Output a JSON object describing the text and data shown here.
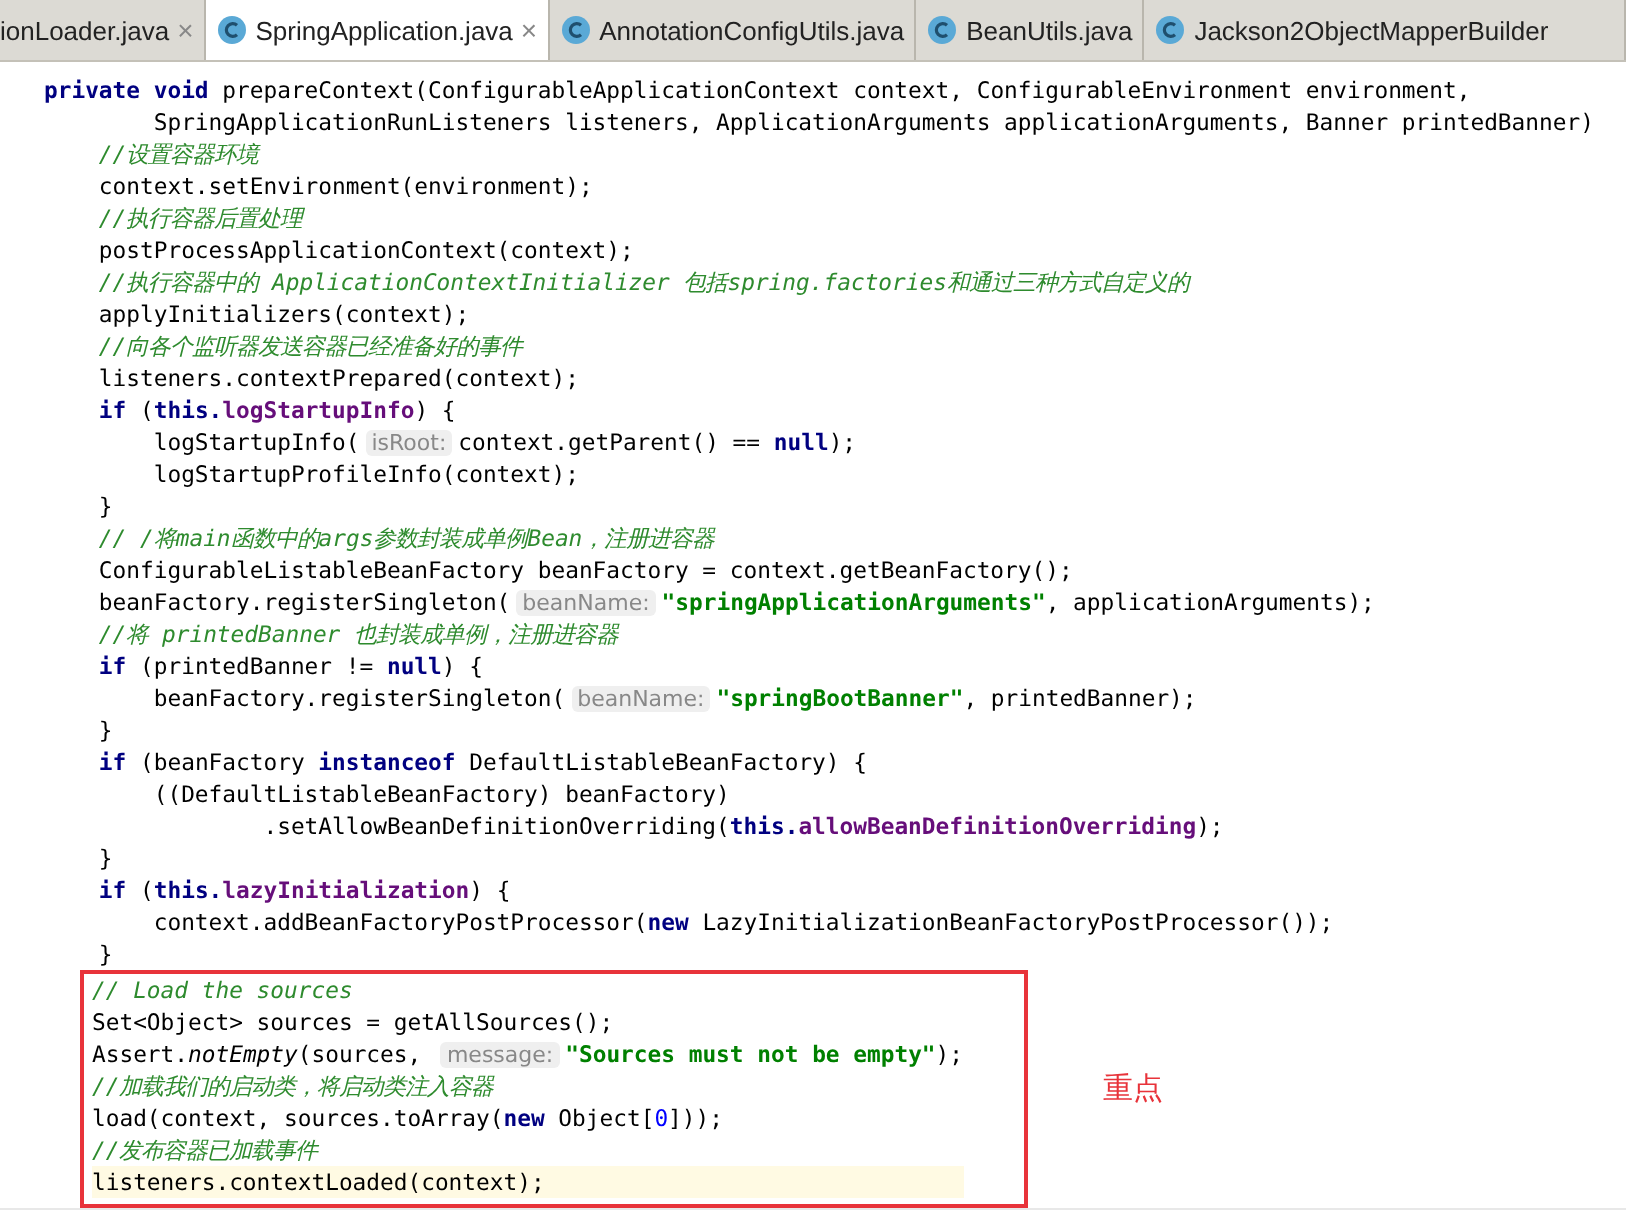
{
  "tabs": [
    {
      "label": "ionLoader.java",
      "selected": false,
      "icon": false,
      "close": "×"
    },
    {
      "label": "SpringApplication.java",
      "selected": true,
      "icon": true,
      "close": "×"
    },
    {
      "label": "AnnotationConfigUtils.java",
      "selected": false,
      "icon": true
    },
    {
      "label": "BeanUtils.java",
      "selected": false,
      "icon": true
    },
    {
      "label": "Jackson2ObjectMapperBuilder",
      "selected": false,
      "icon": true
    }
  ],
  "code_lines": [
    [
      {
        "kind": "keyword",
        "text": "private void "
      },
      {
        "kind": "plain",
        "text": "prepareContext(ConfigurableApplicationContext context, ConfigurableEnvironment environment,"
      }
    ],
    [
      {
        "kind": "plain",
        "text": "        SpringApplicationRunListeners listeners, ApplicationArguments applicationArguments, Banner printedBanner)"
      }
    ],
    [
      {
        "kind": "comment",
        "text": "    //设置容器环境"
      }
    ],
    [
      {
        "kind": "plain",
        "text": "    context.setEnvironment(environment);"
      }
    ],
    [
      {
        "kind": "comment",
        "text": "    //执行容器后置处理"
      }
    ],
    [
      {
        "kind": "plain",
        "text": "    postProcessApplicationContext(context);"
      }
    ],
    [
      {
        "kind": "comment",
        "text": "    //执行容器中的 ApplicationContextInitializer 包括spring.factories和通过三种方式自定义的"
      }
    ],
    [
      {
        "kind": "plain",
        "text": "    applyInitializers(context);"
      }
    ],
    [
      {
        "kind": "comment",
        "text": "    //向各个监听器发送容器已经准备好的事件"
      }
    ],
    [
      {
        "kind": "plain",
        "text": "    listeners.contextPrepared(context);"
      }
    ],
    [
      {
        "kind": "keyword",
        "text": "    if "
      },
      {
        "kind": "plain",
        "text": "("
      },
      {
        "kind": "keyword",
        "text": "this."
      },
      {
        "kind": "field",
        "text": "logStartupInfo"
      },
      {
        "kind": "plain",
        "text": ") {"
      }
    ],
    [
      {
        "kind": "plain",
        "text": "        logStartupInfo("
      },
      {
        "kind": "hint",
        "text": "isRoot:"
      },
      {
        "kind": "plain",
        "text": "context.getParent() == "
      },
      {
        "kind": "keyword",
        "text": "null"
      },
      {
        "kind": "plain",
        "text": ");"
      }
    ],
    [
      {
        "kind": "plain",
        "text": "        logStartupProfileInfo(context);"
      }
    ],
    [
      {
        "kind": "plain",
        "text": "    }"
      }
    ],
    [
      {
        "kind": "comment",
        "text": "    // /将main函数中的args参数封装成单例Bean，注册进容器"
      }
    ],
    [
      {
        "kind": "plain",
        "text": "    ConfigurableListableBeanFactory beanFactory = context.getBeanFactory();"
      }
    ],
    [
      {
        "kind": "plain",
        "text": "    beanFactory.registerSingleton("
      },
      {
        "kind": "hint",
        "text": "beanName:"
      },
      {
        "kind": "string",
        "text": "\"springApplicationArguments\""
      },
      {
        "kind": "plain",
        "text": ", applicationArguments);"
      }
    ],
    [
      {
        "kind": "comment",
        "text": "    //将 printedBanner 也封装成单例，注册进容器"
      }
    ],
    [
      {
        "kind": "keyword",
        "text": "    if "
      },
      {
        "kind": "plain",
        "text": "(printedBanner != "
      },
      {
        "kind": "keyword",
        "text": "null"
      },
      {
        "kind": "plain",
        "text": ") {"
      }
    ],
    [
      {
        "kind": "plain",
        "text": "        beanFactory.registerSingleton("
      },
      {
        "kind": "hint",
        "text": "beanName:"
      },
      {
        "kind": "string",
        "text": "\"springBootBanner\""
      },
      {
        "kind": "plain",
        "text": ", printedBanner);"
      }
    ],
    [
      {
        "kind": "plain",
        "text": "    }"
      }
    ],
    [
      {
        "kind": "keyword",
        "text": "    if "
      },
      {
        "kind": "plain",
        "text": "(beanFactory "
      },
      {
        "kind": "keyword",
        "text": "instanceof "
      },
      {
        "kind": "plain",
        "text": "DefaultListableBeanFactory) {"
      }
    ],
    [
      {
        "kind": "plain",
        "text": "        ((DefaultListableBeanFactory) beanFactory)"
      }
    ],
    [
      {
        "kind": "plain",
        "text": "                .setAllowBeanDefinitionOverriding("
      },
      {
        "kind": "keyword",
        "text": "this."
      },
      {
        "kind": "field",
        "text": "allowBeanDefinitionOverriding"
      },
      {
        "kind": "plain",
        "text": ");"
      }
    ],
    [
      {
        "kind": "plain",
        "text": "    }"
      }
    ],
    [
      {
        "kind": "keyword",
        "text": "    if "
      },
      {
        "kind": "plain",
        "text": "("
      },
      {
        "kind": "keyword",
        "text": "this."
      },
      {
        "kind": "field",
        "text": "lazyInitialization"
      },
      {
        "kind": "plain",
        "text": ") {"
      }
    ],
    [
      {
        "kind": "plain",
        "text": "        context.addBeanFactoryPostProcessor("
      },
      {
        "kind": "keyword",
        "text": "new "
      },
      {
        "kind": "plain",
        "text": "LazyInitializationBeanFactoryPostProcessor());"
      }
    ],
    [
      {
        "kind": "plain",
        "text": "    }"
      }
    ]
  ],
  "highlighted_block": {
    "note": "重点",
    "lines": [
      {
        "current": false,
        "tokens": [
          {
            "kind": "comment",
            "text": "// Load the sources"
          }
        ]
      },
      {
        "current": false,
        "tokens": [
          {
            "kind": "plain",
            "text": "Set<Object> sources = getAllSources();"
          }
        ]
      },
      {
        "current": false,
        "tokens": [
          {
            "kind": "plain",
            "text": "Assert."
          },
          {
            "kind": "static",
            "text": "notEmpty"
          },
          {
            "kind": "plain",
            "text": "(sources, "
          },
          {
            "kind": "hint",
            "text": "message:"
          },
          {
            "kind": "string",
            "text": "\"Sources must not be empty\""
          },
          {
            "kind": "plain",
            "text": ");"
          }
        ]
      },
      {
        "current": false,
        "tokens": [
          {
            "kind": "comment",
            "text": "//加载我们的启动类，将启动类注入容器"
          }
        ]
      },
      {
        "current": false,
        "tokens": [
          {
            "kind": "plain",
            "text": "load(context, sources.toArray("
          },
          {
            "kind": "keyword",
            "text": "new "
          },
          {
            "kind": "plain",
            "text": "Object["
          },
          {
            "kind": "number",
            "text": "0"
          },
          {
            "kind": "plain",
            "text": "]));"
          }
        ]
      },
      {
        "current": false,
        "tokens": [
          {
            "kind": "comment",
            "text": "//发布容器已加载事件"
          }
        ]
      },
      {
        "current": true,
        "tokens": [
          {
            "kind": "plain",
            "text": "listeners.contextLoaded(context);"
          }
        ]
      }
    ]
  }
}
